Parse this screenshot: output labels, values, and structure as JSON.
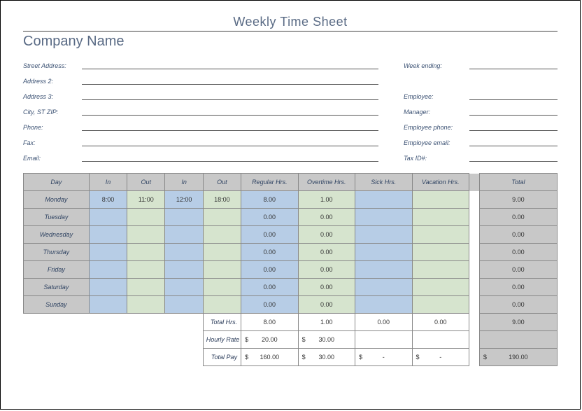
{
  "title": "Weekly Time Sheet",
  "company": "Company Name",
  "leftFields": [
    "Street Address:",
    "Address 2:",
    "Address 3:",
    "City, ST ZIP:",
    "Phone:",
    "Fax:",
    "Email:"
  ],
  "rightFields1": [
    "Week ending:"
  ],
  "rightFields2": [
    "Employee:",
    "Manager:",
    "Employee phone:",
    "Employee email:",
    "Tax ID#:"
  ],
  "columns": [
    "Day",
    "In",
    "Out",
    "In",
    "Out",
    "Regular Hrs.",
    "Overtime Hrs.",
    "Sick Hrs.",
    "Vacation Hrs.",
    "Total"
  ],
  "rows": [
    {
      "day": "Monday",
      "in1": "8:00",
      "out1": "11:00",
      "in2": "12:00",
      "out2": "18:00",
      "reg": "8.00",
      "ot": "1.00",
      "sick": "",
      "vac": "",
      "total": "9.00"
    },
    {
      "day": "Tuesday",
      "in1": "",
      "out1": "",
      "in2": "",
      "out2": "",
      "reg": "0.00",
      "ot": "0.00",
      "sick": "",
      "vac": "",
      "total": "0.00"
    },
    {
      "day": "Wednesday",
      "in1": "",
      "out1": "",
      "in2": "",
      "out2": "",
      "reg": "0.00",
      "ot": "0.00",
      "sick": "",
      "vac": "",
      "total": "0.00"
    },
    {
      "day": "Thursday",
      "in1": "",
      "out1": "",
      "in2": "",
      "out2": "",
      "reg": "0.00",
      "ot": "0.00",
      "sick": "",
      "vac": "",
      "total": "0.00"
    },
    {
      "day": "Friday",
      "in1": "",
      "out1": "",
      "in2": "",
      "out2": "",
      "reg": "0.00",
      "ot": "0.00",
      "sick": "",
      "vac": "",
      "total": "0.00"
    },
    {
      "day": "Saturday",
      "in1": "",
      "out1": "",
      "in2": "",
      "out2": "",
      "reg": "0.00",
      "ot": "0.00",
      "sick": "",
      "vac": "",
      "total": "0.00"
    },
    {
      "day": "Sunday",
      "in1": "",
      "out1": "",
      "in2": "",
      "out2": "",
      "reg": "0.00",
      "ot": "0.00",
      "sick": "",
      "vac": "",
      "total": "0.00"
    }
  ],
  "summary": {
    "totalHrsLabel": "Total Hrs.",
    "totalHrs": {
      "reg": "8.00",
      "ot": "1.00",
      "sick": "0.00",
      "vac": "0.00",
      "total": "9.00"
    },
    "rateLabel": "Hourly Rate",
    "rate": {
      "reg": "20.00",
      "ot": "30.00",
      "sick": "",
      "vac": ""
    },
    "payLabel": "Total Pay",
    "pay": {
      "reg": "160.00",
      "ot": "30.00",
      "sick": "-",
      "vac": "-",
      "total": "190.00"
    },
    "currency": "$"
  }
}
